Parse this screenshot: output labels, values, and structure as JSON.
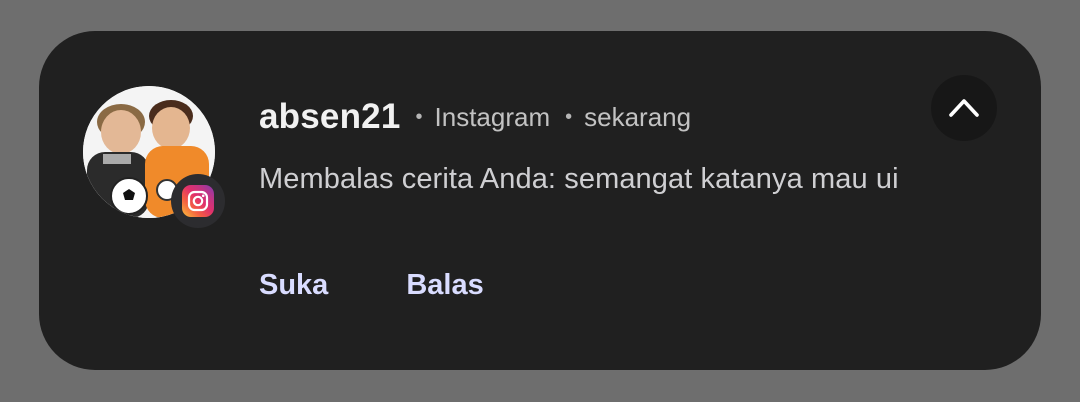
{
  "notification": {
    "sender": "absen21",
    "app_name": "Instagram",
    "time": "sekarang",
    "message": "Membalas cerita Anda: semangat katanya mau ui",
    "app_icon": "instagram-icon",
    "avatar_icon": "profile-photo",
    "collapse_icon": "chevron-up-icon",
    "actions": [
      "Suka",
      "Balas"
    ]
  },
  "colors": {
    "card_background": "#202020",
    "screen_background": "#6e6e6e",
    "action_text": "#d9dcff"
  }
}
